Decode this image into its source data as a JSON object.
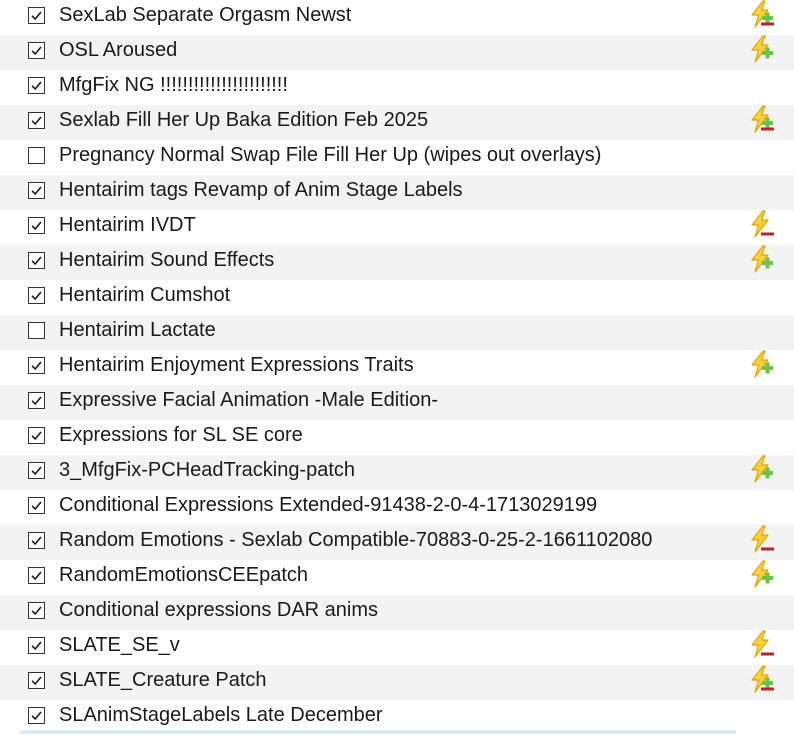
{
  "plugins": [
    {
      "name": "SexLab Separate Orgasm Newst",
      "checked": true,
      "flag": "plugin-add-remove-icon"
    },
    {
      "name": "OSL Aroused",
      "checked": true,
      "flag": "plugin-add-icon"
    },
    {
      "name": "MfgFix NG !!!!!!!!!!!!!!!!!!!!!!!",
      "checked": true,
      "flag": ""
    },
    {
      "name": "Sexlab Fill Her Up Baka Edition Feb 2025",
      "checked": true,
      "flag": "plugin-add-remove-icon"
    },
    {
      "name": "Pregnancy Normal Swap File Fill Her Up (wipes out overlays)",
      "checked": false,
      "flag": ""
    },
    {
      "name": "Hentairim tags Revamp of Anim Stage Labels",
      "checked": true,
      "flag": ""
    },
    {
      "name": "Hentairim IVDT",
      "checked": true,
      "flag": "plugin-remove-icon"
    },
    {
      "name": "Hentairim Sound Effects",
      "checked": true,
      "flag": "plugin-add-icon"
    },
    {
      "name": "Hentairim Cumshot",
      "checked": true,
      "flag": ""
    },
    {
      "name": "Hentairim Lactate",
      "checked": false,
      "flag": ""
    },
    {
      "name": "Hentairim Enjoyment Expressions Traits",
      "checked": true,
      "flag": "plugin-add-icon"
    },
    {
      "name": "Expressive Facial Animation -Male Edition-",
      "checked": true,
      "flag": ""
    },
    {
      "name": "Expressions for SL SE core",
      "checked": true,
      "flag": ""
    },
    {
      "name": "3_MfgFix-PCHeadTracking-patch",
      "checked": true,
      "flag": "plugin-add-icon"
    },
    {
      "name": "Conditional Expressions Extended-91438-2-0-4-1713029199",
      "checked": true,
      "flag": ""
    },
    {
      "name": "Random Emotions - Sexlab Compatible-70883-0-25-2-1661102080",
      "checked": true,
      "flag": "plugin-remove-icon"
    },
    {
      "name": "RandomEmotionsCEEpatch",
      "checked": true,
      "flag": "plugin-add-icon"
    },
    {
      "name": "Conditional expressions DAR anims",
      "checked": true,
      "flag": ""
    },
    {
      "name": "SLATE_SE_v",
      "checked": true,
      "flag": "plugin-remove-icon"
    },
    {
      "name": "SLATE_Creature Patch",
      "checked": true,
      "flag": "plugin-add-remove-icon"
    },
    {
      "name": "SLAnimStageLabels Late December",
      "checked": true,
      "flag": ""
    }
  ],
  "colors": {
    "alt_row": "#f3f3f3",
    "bolt_fill": "#ffd43b",
    "bolt_stroke": "#e8a100",
    "plus": "#6cc24a",
    "minus": "#b3262d",
    "selection_strip": "#d7ecf7"
  }
}
